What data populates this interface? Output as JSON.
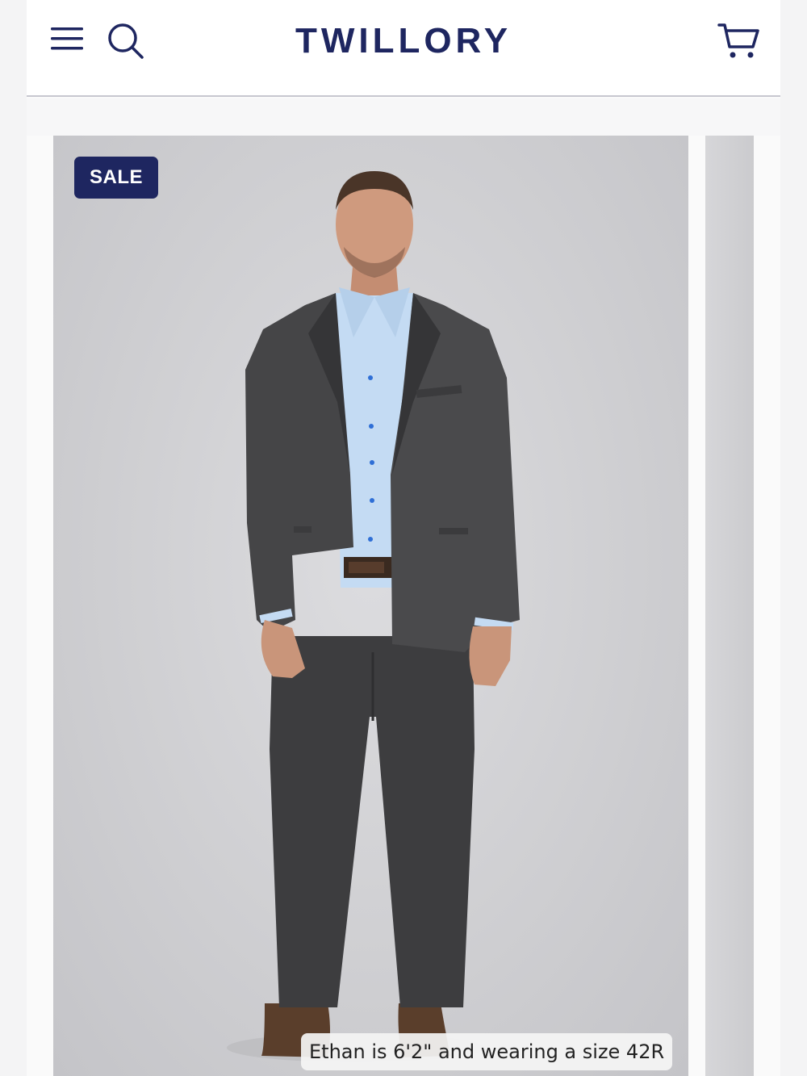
{
  "header": {
    "brand": "TWILLORY",
    "menu_icon": "hamburger-menu-icon",
    "search_icon": "search-icon",
    "cart_icon": "shopping-cart-icon"
  },
  "product": {
    "badge": "SALE",
    "model_caption": "Ethan is 6'2\" and wearing a size 42R"
  },
  "colors": {
    "brand_navy": "#1e2660",
    "background": "#f4f4f5",
    "suit_charcoal": "#3f3f41",
    "shirt_light_blue": "#c4dbf3"
  }
}
